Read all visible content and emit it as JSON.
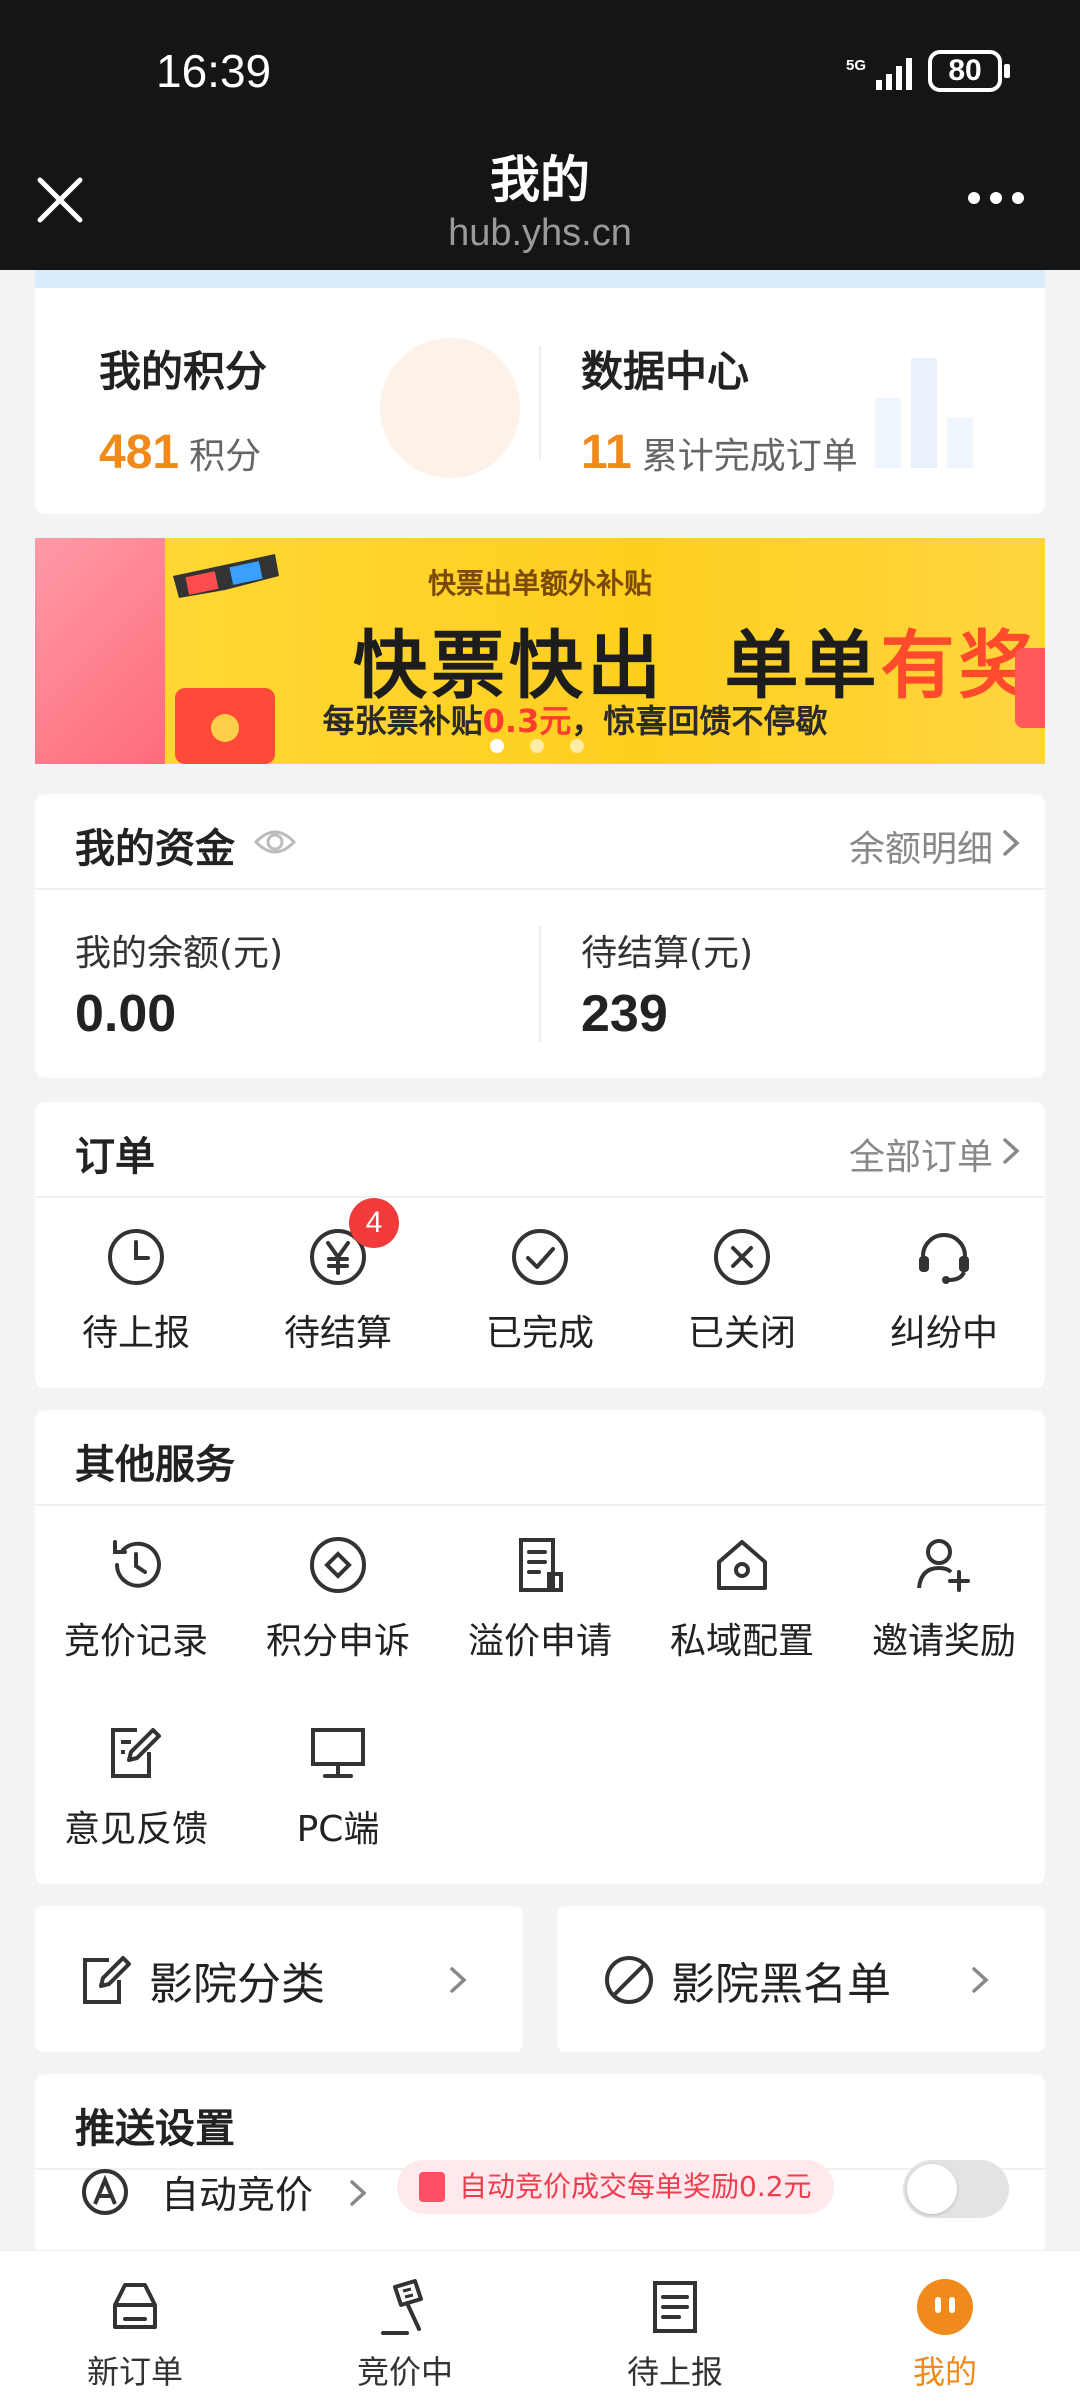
{
  "status_bar": {
    "time": "16:39",
    "network": "5G",
    "battery": "80"
  },
  "nav": {
    "title": "我的",
    "subtitle": "hub.yhs.cn"
  },
  "score_card": {
    "points_label": "我的积分",
    "points_value": "481",
    "points_unit": "积分",
    "data_label": "数据中心",
    "orders_value": "11",
    "orders_unit": "累计完成订单"
  },
  "banner": {
    "small_title": "快票出单额外补贴",
    "big_left": "快票快出",
    "big_mid": "单单",
    "big_red": "有奖",
    "desc_prefix": "每张票补贴",
    "desc_amount": "0.3元",
    "desc_suffix": "，惊喜回馈不停歇"
  },
  "funds": {
    "title": "我的资金",
    "detail_link": "余额明细",
    "balance_label": "我的余额(元)",
    "balance_value": "0.00",
    "pending_label": "待结算(元)",
    "pending_value": "239"
  },
  "orders": {
    "title": "订单",
    "all_link": "全部订单",
    "items": [
      {
        "label": "待上报",
        "icon": "clock-icon"
      },
      {
        "label": "待结算",
        "icon": "yen-icon",
        "badge": "4"
      },
      {
        "label": "已完成",
        "icon": "check-circle-icon"
      },
      {
        "label": "已关闭",
        "icon": "x-circle-icon"
      },
      {
        "label": "纠纷中",
        "icon": "headset-icon"
      }
    ]
  },
  "services": {
    "title": "其他服务",
    "items": [
      {
        "label": "竞价记录",
        "icon": "history-icon"
      },
      {
        "label": "积分申诉",
        "icon": "diamond-icon"
      },
      {
        "label": "溢价申请",
        "icon": "document-icon"
      },
      {
        "label": "私域配置",
        "icon": "house-gear-icon"
      },
      {
        "label": "邀请奖励",
        "icon": "add-user-icon"
      },
      {
        "label": "意见反馈",
        "icon": "edit-icon"
      },
      {
        "label": "PC端",
        "icon": "monitor-icon"
      }
    ]
  },
  "quick_links": {
    "cinema_category": "影院分类",
    "cinema_blacklist": "影院黑名单"
  },
  "push_settings": {
    "title": "推送设置",
    "auto_bid_label": "自动竞价",
    "promo": "自动竞价成交每单奖励0.2元",
    "auto_bid_enabled": false
  },
  "tabbar": {
    "items": [
      {
        "label": "新订单",
        "icon": "tray-icon"
      },
      {
        "label": "竞价中",
        "icon": "gavel-icon"
      },
      {
        "label": "待上报",
        "icon": "list-doc-icon"
      },
      {
        "label": "我的",
        "icon": "profile-icon",
        "active": true
      }
    ]
  },
  "colors": {
    "accent": "#f08a1c",
    "badge": "#f23a3a",
    "dark_bar": "#151515"
  }
}
